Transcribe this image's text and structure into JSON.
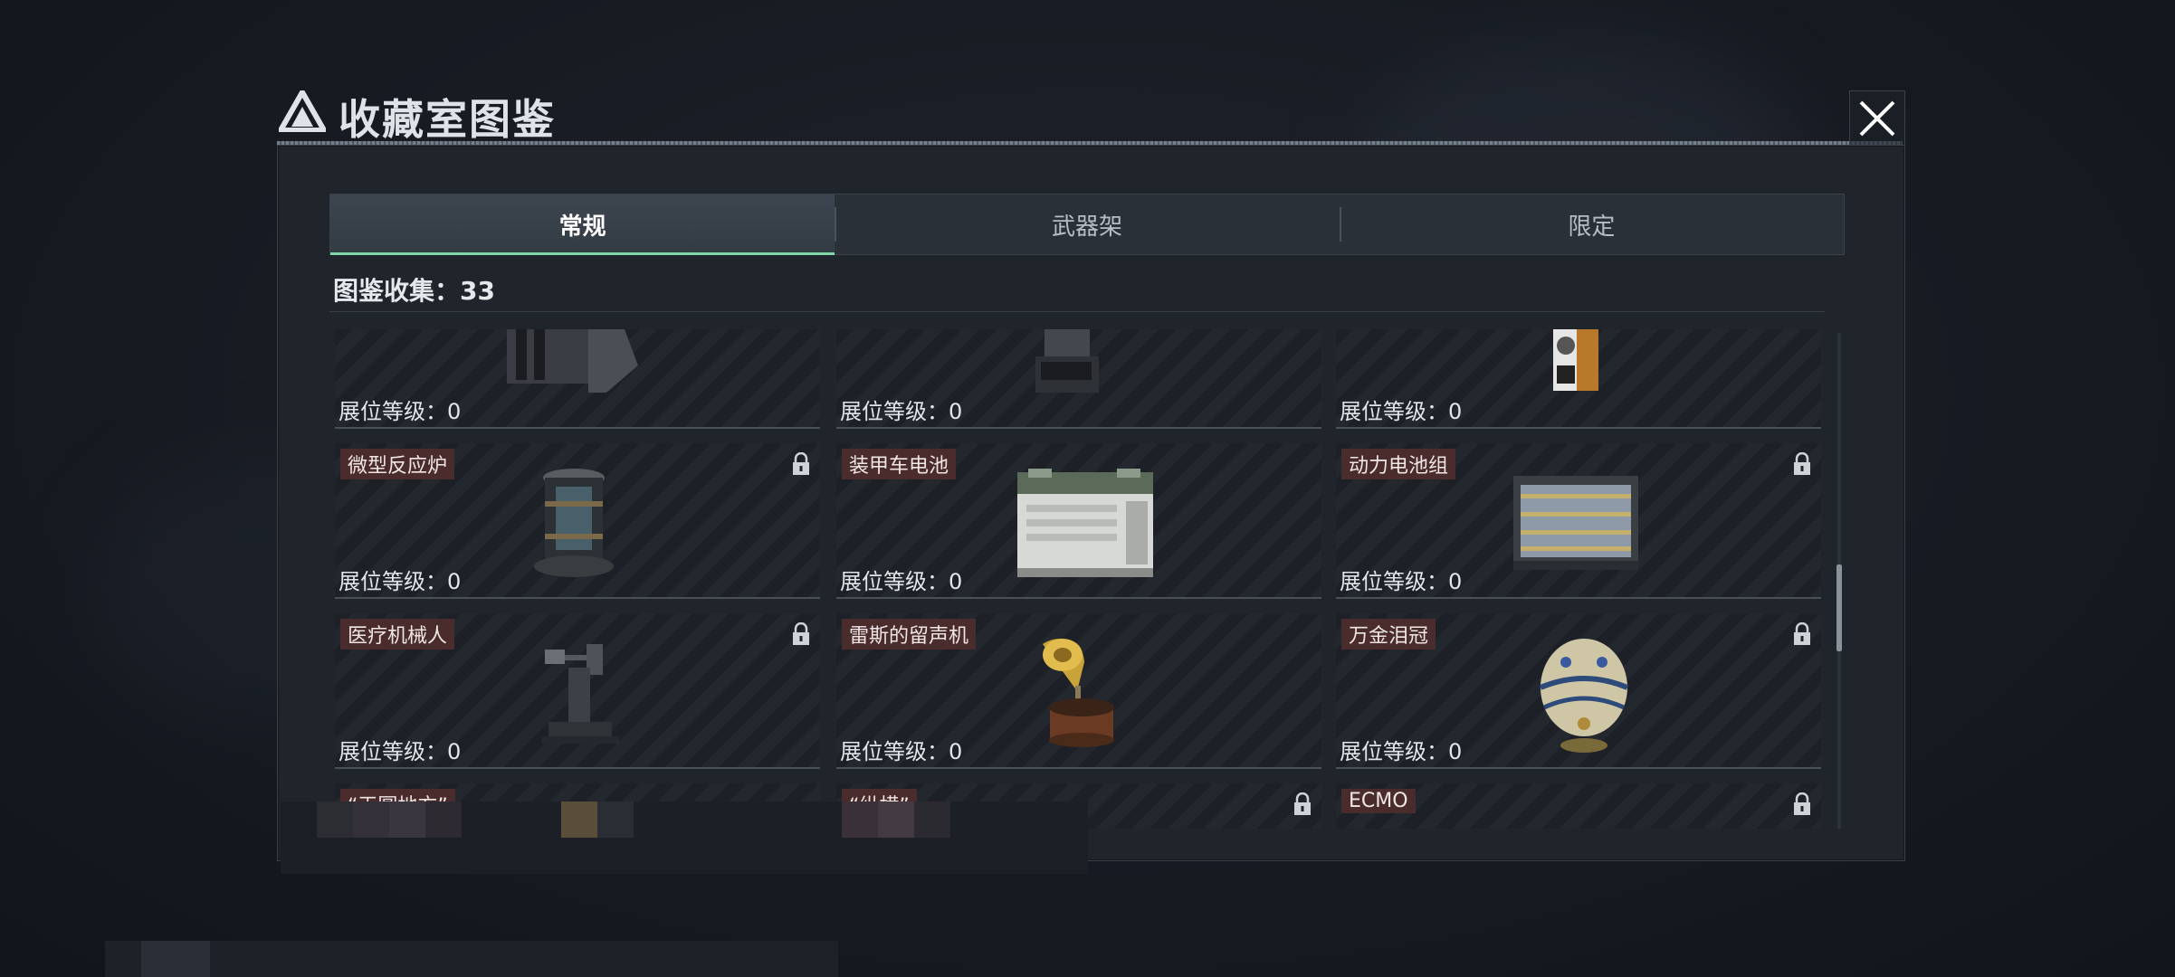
{
  "header": {
    "title": "收藏室图鉴",
    "logo_icon": "triangle-logo-icon",
    "close_icon": "close-icon"
  },
  "tabs": [
    {
      "label": "常规",
      "active": true
    },
    {
      "label": "武器架",
      "active": false
    },
    {
      "label": "限定",
      "active": false
    }
  ],
  "collection": {
    "label": "图鉴收集：",
    "count": "33"
  },
  "level_label": "展位等级：",
  "items": [
    {
      "name": "",
      "level": "0",
      "locked": false,
      "icon": "machine-icon"
    },
    {
      "name": "",
      "level": "0",
      "locked": false,
      "icon": "dock-icon"
    },
    {
      "name": "",
      "level": "0",
      "locked": false,
      "icon": "coffee-bag-icon"
    },
    {
      "name": "微型反应炉",
      "level": "0",
      "locked": true,
      "icon": "reactor-icon"
    },
    {
      "name": "装甲车电池",
      "level": "0",
      "locked": false,
      "icon": "battery-icon"
    },
    {
      "name": "动力电池组",
      "level": "0",
      "locked": true,
      "icon": "battery-pack-icon"
    },
    {
      "name": "医疗机械人",
      "level": "0",
      "locked": true,
      "icon": "medical-robot-icon"
    },
    {
      "name": "雷斯的留声机",
      "level": "0",
      "locked": false,
      "icon": "gramophone-icon"
    },
    {
      "name": "万金泪冠",
      "level": "0",
      "locked": true,
      "icon": "jeweled-egg-icon"
    },
    {
      "name": "“天圆地方”",
      "level": "",
      "locked": false,
      "icon": ""
    },
    {
      "name": "“纵横”",
      "level": "",
      "locked": true,
      "icon": ""
    },
    {
      "name": "ECMO",
      "level": "",
      "locked": true,
      "icon": ""
    }
  ],
  "colors": {
    "accent": "#7fd6a6",
    "name_badge": "#4a2c2c",
    "panel": "#20252c"
  }
}
